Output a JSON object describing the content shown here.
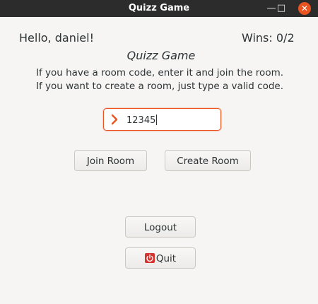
{
  "window": {
    "title": "Quizz Game",
    "controls": {
      "minimize": "—",
      "maximize": "□",
      "close": "✕"
    }
  },
  "header": {
    "greeting": "Hello, daniel!",
    "wins": "Wins: 0/2"
  },
  "main": {
    "heading": "Quizz Game",
    "instruction_line1": "If you have a room code, enter it and join the room.",
    "instruction_line2": "If you want to create a room, just type a valid code.",
    "room_code": {
      "value": "12345",
      "icon": "chevron-right-icon"
    },
    "join_label": "Join Room",
    "create_label": "Create Room",
    "logout_label": "Logout",
    "quit_label": "Quit",
    "quit_icon": "power-icon"
  },
  "colors": {
    "accent": "#e95420",
    "titlebar": "#2c2c2c",
    "background": "#f6f5f4",
    "quit_icon": "#d6332f"
  }
}
